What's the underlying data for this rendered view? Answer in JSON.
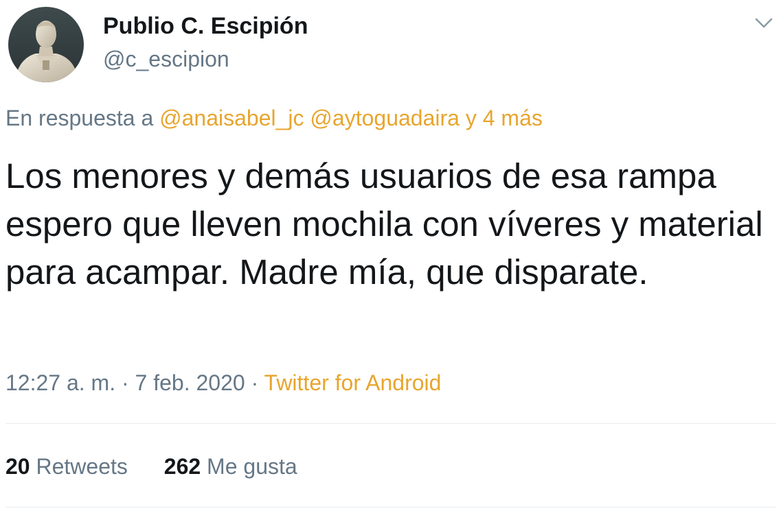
{
  "author": {
    "display_name": "Publio C. Escipión",
    "handle": "@c_escipion",
    "avatar_icon": "bust-statue-avatar"
  },
  "reply": {
    "prefix": "En respuesta a",
    "mention_1": "@anaisabel_jc",
    "mention_2": "@aytoguadaira",
    "more": "y 4 más"
  },
  "tweet": {
    "text": "Los menores y demás usuarios de esa rampa espero que lleven mochila con víveres y material para acampar. Madre mía, que disparate."
  },
  "meta": {
    "time": "12:27 a. m.",
    "separator_1": "·",
    "date": "7 feb. 2020",
    "separator_2": "·",
    "source": "Twitter for Android"
  },
  "stats": {
    "retweets_count": "20",
    "retweets_label": "Retweets",
    "likes_count": "262",
    "likes_label": "Me gusta"
  },
  "colors": {
    "link_accent": "#e8a52e",
    "secondary_text": "#657786",
    "primary_text": "#14171a",
    "divider": "#e6ecf0"
  },
  "icons": {
    "menu": "chevron-down-icon"
  }
}
